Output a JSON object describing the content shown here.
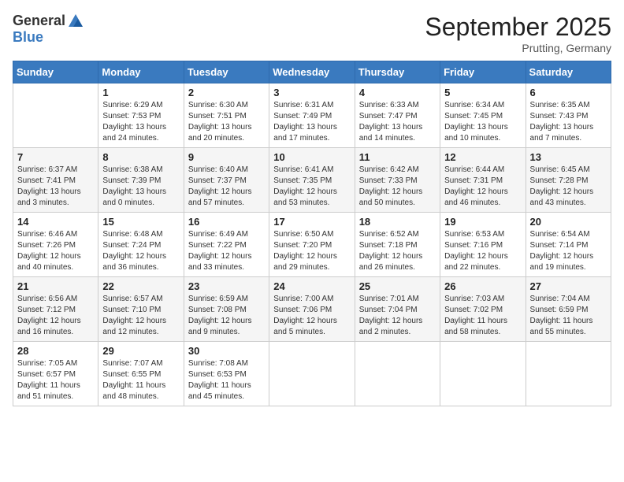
{
  "header": {
    "logo_general": "General",
    "logo_blue": "Blue",
    "month_title": "September 2025",
    "location": "Prutting, Germany"
  },
  "days_of_week": [
    "Sunday",
    "Monday",
    "Tuesday",
    "Wednesday",
    "Thursday",
    "Friday",
    "Saturday"
  ],
  "weeks": [
    [
      {
        "day": "",
        "sunrise": "",
        "sunset": "",
        "daylight": ""
      },
      {
        "day": "1",
        "sunrise": "Sunrise: 6:29 AM",
        "sunset": "Sunset: 7:53 PM",
        "daylight": "Daylight: 13 hours and 24 minutes."
      },
      {
        "day": "2",
        "sunrise": "Sunrise: 6:30 AM",
        "sunset": "Sunset: 7:51 PM",
        "daylight": "Daylight: 13 hours and 20 minutes."
      },
      {
        "day": "3",
        "sunrise": "Sunrise: 6:31 AM",
        "sunset": "Sunset: 7:49 PM",
        "daylight": "Daylight: 13 hours and 17 minutes."
      },
      {
        "day": "4",
        "sunrise": "Sunrise: 6:33 AM",
        "sunset": "Sunset: 7:47 PM",
        "daylight": "Daylight: 13 hours and 14 minutes."
      },
      {
        "day": "5",
        "sunrise": "Sunrise: 6:34 AM",
        "sunset": "Sunset: 7:45 PM",
        "daylight": "Daylight: 13 hours and 10 minutes."
      },
      {
        "day": "6",
        "sunrise": "Sunrise: 6:35 AM",
        "sunset": "Sunset: 7:43 PM",
        "daylight": "Daylight: 13 hours and 7 minutes."
      }
    ],
    [
      {
        "day": "7",
        "sunrise": "Sunrise: 6:37 AM",
        "sunset": "Sunset: 7:41 PM",
        "daylight": "Daylight: 13 hours and 3 minutes."
      },
      {
        "day": "8",
        "sunrise": "Sunrise: 6:38 AM",
        "sunset": "Sunset: 7:39 PM",
        "daylight": "Daylight: 13 hours and 0 minutes."
      },
      {
        "day": "9",
        "sunrise": "Sunrise: 6:40 AM",
        "sunset": "Sunset: 7:37 PM",
        "daylight": "Daylight: 12 hours and 57 minutes."
      },
      {
        "day": "10",
        "sunrise": "Sunrise: 6:41 AM",
        "sunset": "Sunset: 7:35 PM",
        "daylight": "Daylight: 12 hours and 53 minutes."
      },
      {
        "day": "11",
        "sunrise": "Sunrise: 6:42 AM",
        "sunset": "Sunset: 7:33 PM",
        "daylight": "Daylight: 12 hours and 50 minutes."
      },
      {
        "day": "12",
        "sunrise": "Sunrise: 6:44 AM",
        "sunset": "Sunset: 7:31 PM",
        "daylight": "Daylight: 12 hours and 46 minutes."
      },
      {
        "day": "13",
        "sunrise": "Sunrise: 6:45 AM",
        "sunset": "Sunset: 7:28 PM",
        "daylight": "Daylight: 12 hours and 43 minutes."
      }
    ],
    [
      {
        "day": "14",
        "sunrise": "Sunrise: 6:46 AM",
        "sunset": "Sunset: 7:26 PM",
        "daylight": "Daylight: 12 hours and 40 minutes."
      },
      {
        "day": "15",
        "sunrise": "Sunrise: 6:48 AM",
        "sunset": "Sunset: 7:24 PM",
        "daylight": "Daylight: 12 hours and 36 minutes."
      },
      {
        "day": "16",
        "sunrise": "Sunrise: 6:49 AM",
        "sunset": "Sunset: 7:22 PM",
        "daylight": "Daylight: 12 hours and 33 minutes."
      },
      {
        "day": "17",
        "sunrise": "Sunrise: 6:50 AM",
        "sunset": "Sunset: 7:20 PM",
        "daylight": "Daylight: 12 hours and 29 minutes."
      },
      {
        "day": "18",
        "sunrise": "Sunrise: 6:52 AM",
        "sunset": "Sunset: 7:18 PM",
        "daylight": "Daylight: 12 hours and 26 minutes."
      },
      {
        "day": "19",
        "sunrise": "Sunrise: 6:53 AM",
        "sunset": "Sunset: 7:16 PM",
        "daylight": "Daylight: 12 hours and 22 minutes."
      },
      {
        "day": "20",
        "sunrise": "Sunrise: 6:54 AM",
        "sunset": "Sunset: 7:14 PM",
        "daylight": "Daylight: 12 hours and 19 minutes."
      }
    ],
    [
      {
        "day": "21",
        "sunrise": "Sunrise: 6:56 AM",
        "sunset": "Sunset: 7:12 PM",
        "daylight": "Daylight: 12 hours and 16 minutes."
      },
      {
        "day": "22",
        "sunrise": "Sunrise: 6:57 AM",
        "sunset": "Sunset: 7:10 PM",
        "daylight": "Daylight: 12 hours and 12 minutes."
      },
      {
        "day": "23",
        "sunrise": "Sunrise: 6:59 AM",
        "sunset": "Sunset: 7:08 PM",
        "daylight": "Daylight: 12 hours and 9 minutes."
      },
      {
        "day": "24",
        "sunrise": "Sunrise: 7:00 AM",
        "sunset": "Sunset: 7:06 PM",
        "daylight": "Daylight: 12 hours and 5 minutes."
      },
      {
        "day": "25",
        "sunrise": "Sunrise: 7:01 AM",
        "sunset": "Sunset: 7:04 PM",
        "daylight": "Daylight: 12 hours and 2 minutes."
      },
      {
        "day": "26",
        "sunrise": "Sunrise: 7:03 AM",
        "sunset": "Sunset: 7:02 PM",
        "daylight": "Daylight: 11 hours and 58 minutes."
      },
      {
        "day": "27",
        "sunrise": "Sunrise: 7:04 AM",
        "sunset": "Sunset: 6:59 PM",
        "daylight": "Daylight: 11 hours and 55 minutes."
      }
    ],
    [
      {
        "day": "28",
        "sunrise": "Sunrise: 7:05 AM",
        "sunset": "Sunset: 6:57 PM",
        "daylight": "Daylight: 11 hours and 51 minutes."
      },
      {
        "day": "29",
        "sunrise": "Sunrise: 7:07 AM",
        "sunset": "Sunset: 6:55 PM",
        "daylight": "Daylight: 11 hours and 48 minutes."
      },
      {
        "day": "30",
        "sunrise": "Sunrise: 7:08 AM",
        "sunset": "Sunset: 6:53 PM",
        "daylight": "Daylight: 11 hours and 45 minutes."
      },
      {
        "day": "",
        "sunrise": "",
        "sunset": "",
        "daylight": ""
      },
      {
        "day": "",
        "sunrise": "",
        "sunset": "",
        "daylight": ""
      },
      {
        "day": "",
        "sunrise": "",
        "sunset": "",
        "daylight": ""
      },
      {
        "day": "",
        "sunrise": "",
        "sunset": "",
        "daylight": ""
      }
    ]
  ]
}
